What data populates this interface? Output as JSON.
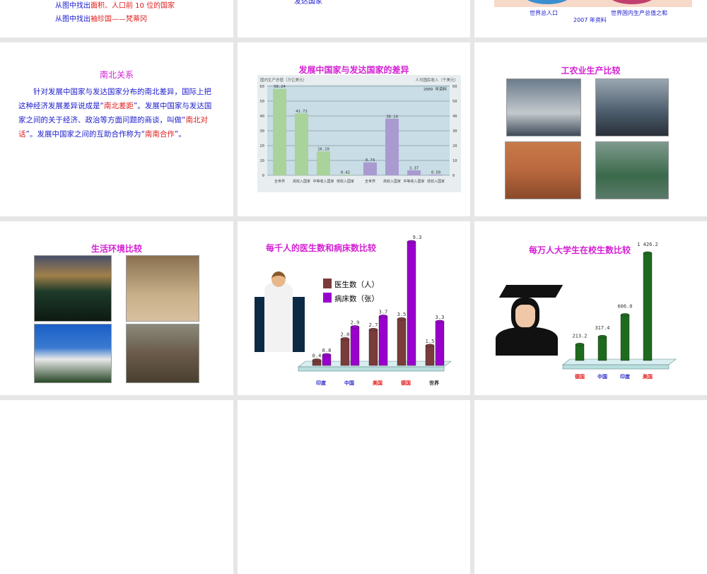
{
  "slide_top_left": {
    "line1_prefix": "从图中找出",
    "line1_red": "面积、人口前 10 位的国家",
    "line2_prefix": "从图中找出",
    "line2_red": "袖珍国——梵蒂冈"
  },
  "slide_top_mid": {
    "text": "发达国家"
  },
  "slide_top_right": {
    "label_population": "世界总人口",
    "label_gdp": "世界国内生产总值之和",
    "label_year": "2007 年资料"
  },
  "slide_north_south": {
    "title": "南北关系",
    "p1": "针对发展中国家与发达国家分布的南北差异，国际上把这种经济发展差异说成是“",
    "r1": "南北差距",
    "p2": "”。发展中国家与发达国家之间的关于经济、政治等方面问题的商谈，叫做“",
    "r2": "南北对话",
    "p3": "”。发展中国家之间的互助合作称为“",
    "r3": "南南合作",
    "p4": "”。"
  },
  "slide_industry": {
    "title": "工农业生产比较"
  },
  "slide_living": {
    "title": "生活环境比较"
  },
  "colors": {
    "green": "#a9d39a",
    "purple": "#a99bd0",
    "brown": "#7a3b3b",
    "violet": "#9a00cc",
    "darkgreen": "#1e6b1e"
  },
  "chart_data": [
    {
      "type": "bar",
      "title": "发展中国家与发达国家的差异",
      "ylabel_left": "国内生产总值（万亿美元）",
      "ylabel_right": "人均国民收入（千美元）",
      "note": "2009 年资料",
      "ylim": [
        0,
        60
      ],
      "yticks": [
        0,
        10,
        20,
        30,
        40,
        50,
        60
      ],
      "categories": [
        "全世界",
        "高收入国家",
        "中等收入国家",
        "低收入国家",
        "全世界",
        "高收入国家",
        "中等收入国家",
        "低收入国家"
      ],
      "values": [
        58.24,
        41.72,
        16.1,
        0.42,
        8.74,
        38.14,
        3.37,
        0.5
      ],
      "value_labels": [
        "58.24",
        "41.72",
        "16.10",
        "0.42",
        "8.74",
        "38.14",
        "3.37",
        "0.50"
      ]
    },
    {
      "type": "bar",
      "title": "每千人的医生数和病床数比较",
      "categories": [
        "印度",
        "中国",
        "美国",
        "德国",
        "世界"
      ],
      "series": [
        {
          "name": "医生数（人）",
          "values": [
            0.4,
            2.0,
            2.7,
            3.5,
            1.5
          ]
        },
        {
          "name": "病床数（张）",
          "values": [
            0.8,
            2.9,
            3.7,
            9.3,
            3.3
          ]
        }
      ]
    },
    {
      "type": "bar",
      "title": "每万人大学生在校生数比较",
      "categories": [
        "德国",
        "中国",
        "印度",
        "美国"
      ],
      "values": [
        213.2,
        317.4,
        606.0,
        1426.2
      ],
      "value_labels": [
        "213.2",
        "317.4",
        "606.0",
        "1 426.2"
      ]
    }
  ]
}
